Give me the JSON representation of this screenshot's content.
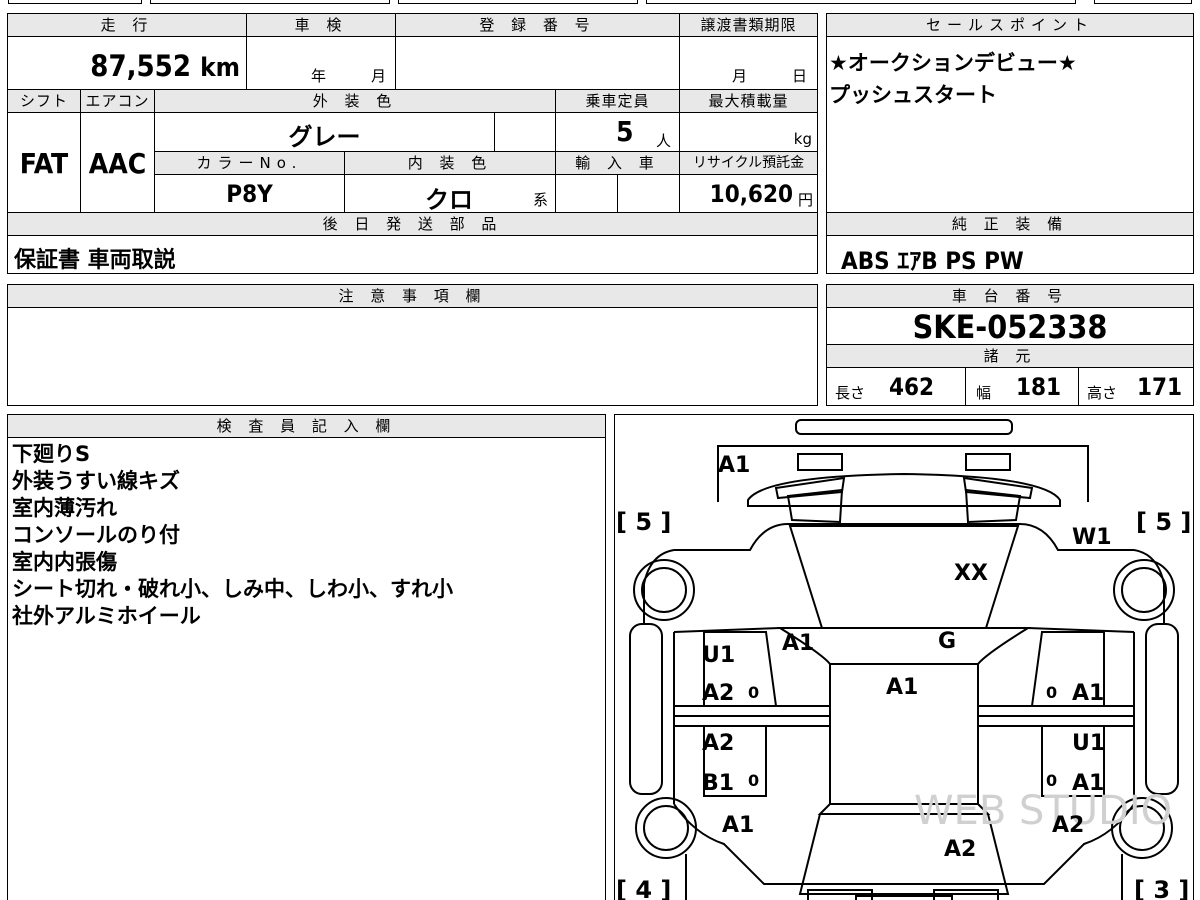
{
  "headers": {
    "mileage": "走 行",
    "inspection": "車 検",
    "registration_no": "登 録 番 号",
    "transfer_deadline": "譲渡書類期限",
    "sales_point": "セールスポイント",
    "shift": "シフト",
    "aircon": "エアコン",
    "exterior_color": "外 装 色",
    "capacity": "乗車定員",
    "max_load": "最大積載量",
    "color_no": "カラーNo.",
    "interior_color": "内 装 色",
    "import_car": "輸 入 車",
    "recycle_fee": "リサイクル預託金",
    "later_parts": "後 日 発 送 部 品",
    "factory_equipment": "純 正 装 備",
    "notes": "注 意 事 項 欄",
    "chassis_no": "車 台 番 号",
    "specs": "諸 元",
    "inspector": "検 査 員 記 入 欄"
  },
  "vehicle": {
    "mileage": "87,552",
    "mileage_unit": "km",
    "inspection_year_unit": "年",
    "inspection_month_unit": "月",
    "deadline_month_unit": "月",
    "deadline_day_unit": "日",
    "shift": "FAT",
    "aircon": "AAC",
    "exterior_color": "グレー",
    "capacity": "5",
    "capacity_unit": "人",
    "max_load_unit": "kg",
    "color_no": "P8Y",
    "interior_color": "クロ",
    "interior_suffix": "系",
    "recycle_fee": "10,620",
    "recycle_unit": "円",
    "later_parts": "保証書 車両取説",
    "factory_equipment": "ABS ｴｱB PS PW",
    "chassis_no": "SKE-052338",
    "length_label": "長さ",
    "length": "462",
    "width_label": "幅",
    "width": "181",
    "height_label": "高さ",
    "height": "171"
  },
  "sales_points": [
    "★オークションデビュー★",
    "プッシュスタート"
  ],
  "inspector_notes": [
    "下廻りS",
    "外装うすい線キズ",
    "室内薄汚れ",
    "コンソールのり付",
    "室内内張傷",
    "シート切れ・破れ小、しみ中、しわ小、すれ小",
    "社外アルミホイール"
  ],
  "diagram": {
    "tire_tread": [
      "[ 5 ]",
      "[ 5 ]",
      "[ 4 ]",
      "[ 3 ]"
    ],
    "marks": [
      "A1",
      "W1",
      "XX",
      "A1",
      "G",
      "U1",
      "A2",
      "A1",
      "A1",
      "A2",
      "U1",
      "B1",
      "A1",
      "A1",
      "A2",
      "A2"
    ],
    "tire_zero": "0",
    "watermark": "WEB STUDIO"
  }
}
